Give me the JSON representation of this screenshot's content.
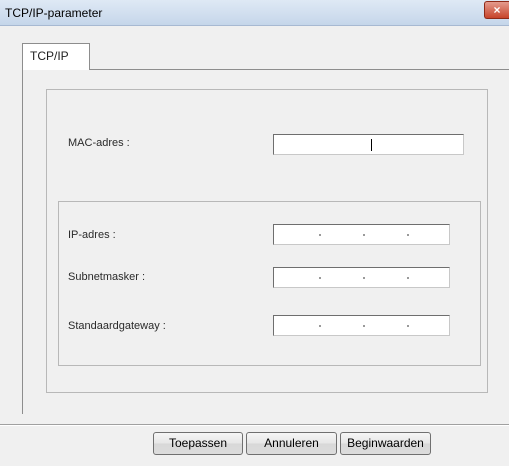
{
  "window": {
    "title": "TCP/IP-parameter",
    "close_glyph": "×"
  },
  "tabs": [
    {
      "label": "TCP/IP",
      "selected": true
    }
  ],
  "form": {
    "mac_label": "MAC-adres :",
    "mac_value": "",
    "ip_label": "IP-adres :",
    "ip_value": ". . .",
    "subnet_label": "Subnetmasker :",
    "subnet_value": ". . .",
    "gateway_label": "Standaardgateway :",
    "gateway_value": ". . ."
  },
  "buttons": {
    "apply": "Toepassen",
    "cancel": "Annuleren",
    "defaults": "Beginwaarden"
  },
  "colors": {
    "close_button": "#c7442b",
    "titlebar": "#c5d6ea"
  }
}
